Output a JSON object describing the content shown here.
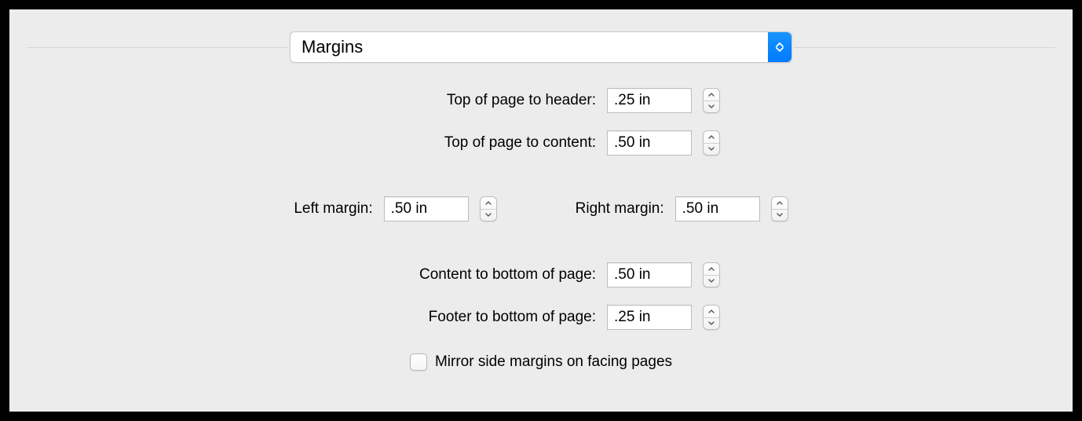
{
  "dropdown": {
    "selected": "Margins"
  },
  "fields": {
    "top_header": {
      "label": "Top of page to header:",
      "value": ".25 in"
    },
    "top_content": {
      "label": "Top of page to content:",
      "value": ".50 in"
    },
    "left_margin": {
      "label": "Left margin:",
      "value": ".50 in"
    },
    "right_margin": {
      "label": "Right margin:",
      "value": ".50 in"
    },
    "content_bottom": {
      "label": "Content to bottom of page:",
      "value": ".50 in"
    },
    "footer_bottom": {
      "label": "Footer to bottom of page:",
      "value": ".25 in"
    }
  },
  "mirror": {
    "label": "Mirror side margins on facing pages",
    "checked": false
  }
}
